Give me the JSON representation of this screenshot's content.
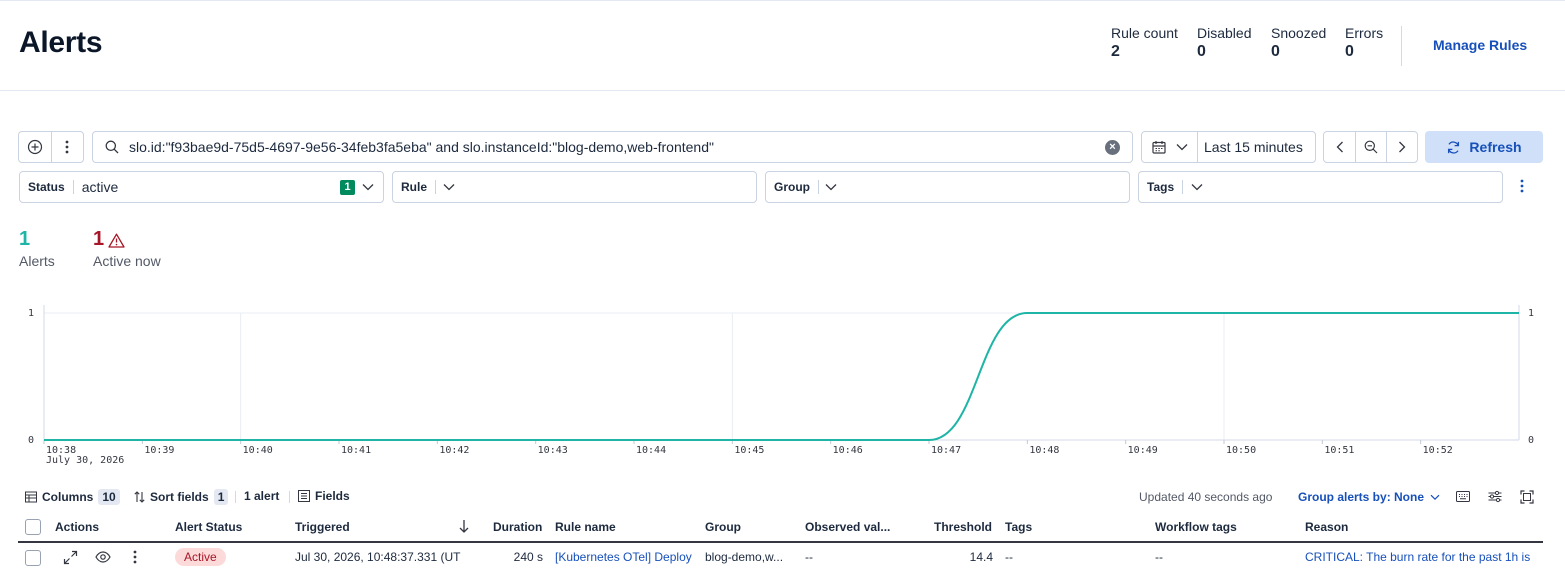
{
  "header": {
    "title": "Alerts",
    "stats": [
      {
        "label": "Rule count",
        "value": "2"
      },
      {
        "label": "Disabled",
        "value": "0"
      },
      {
        "label": "Snoozed",
        "value": "0"
      },
      {
        "label": "Errors",
        "value": "0"
      }
    ],
    "manage_rules": "Manage Rules"
  },
  "query_bar": {
    "query": "slo.id:\"f93bae9d-75d5-4697-9e56-34feb3fa5eba\" and slo.instanceId:\"blog-demo,web-frontend\"",
    "time_range": "Last 15 minutes",
    "refresh": "Refresh"
  },
  "filters": [
    {
      "label": "Status",
      "value": "active",
      "count": "1"
    },
    {
      "label": "Rule",
      "value": ""
    },
    {
      "label": "Group",
      "value": ""
    },
    {
      "label": "Tags",
      "value": ""
    }
  ],
  "summary": {
    "alerts_count": "1",
    "alerts_label": "Alerts",
    "active_count": "1",
    "active_label": "Active now",
    "alerts_color": "#1fb5a6",
    "active_color": "#a71627"
  },
  "chart_data": {
    "type": "area",
    "x_ticks": [
      "10:38",
      "10:39",
      "10:40",
      "10:41",
      "10:42",
      "10:43",
      "10:44",
      "10:45",
      "10:46",
      "10:47",
      "10:48",
      "10:49",
      "10:50",
      "10:51",
      "10:52"
    ],
    "x_sublabel": "July 30, 2026",
    "y_ticks_left": [
      "0",
      "1"
    ],
    "y_ticks_right": [
      "0",
      "1"
    ],
    "ylim": [
      0,
      1
    ],
    "xlim": [
      "10:38",
      "10:53"
    ],
    "series": [
      {
        "color": "#1fb5a6",
        "points": [
          [
            "10:38",
            0
          ],
          [
            "10:47",
            0
          ],
          [
            "10:48",
            1
          ],
          [
            "10:53",
            1
          ]
        ]
      }
    ]
  },
  "toolbar": {
    "columns_label": "Columns",
    "columns_count": "10",
    "sort_label": "Sort fields",
    "sort_count": "1",
    "alert_count": "1 alert",
    "fields_label": "Fields",
    "updated": "Updated 40 seconds ago",
    "group_by": "Group alerts by: None"
  },
  "table": {
    "columns": [
      "Actions",
      "Alert Status",
      "Triggered",
      "Duration",
      "Rule name",
      "Group",
      "Observed val...",
      "Threshold",
      "Tags",
      "Workflow tags",
      "Reason"
    ],
    "rows": [
      {
        "status": "Active",
        "triggered": "Jul 30, 2026, 10:48:37.331 (UT",
        "duration": "240 s",
        "rule_name": "[Kubernetes OTel] Deploy",
        "group": "blog-demo,w...",
        "observed": "--",
        "threshold": "14.4",
        "tags": "--",
        "workflow_tags": "--",
        "reason": "CRITICAL: The burn rate for the past 1h is"
      }
    ]
  }
}
